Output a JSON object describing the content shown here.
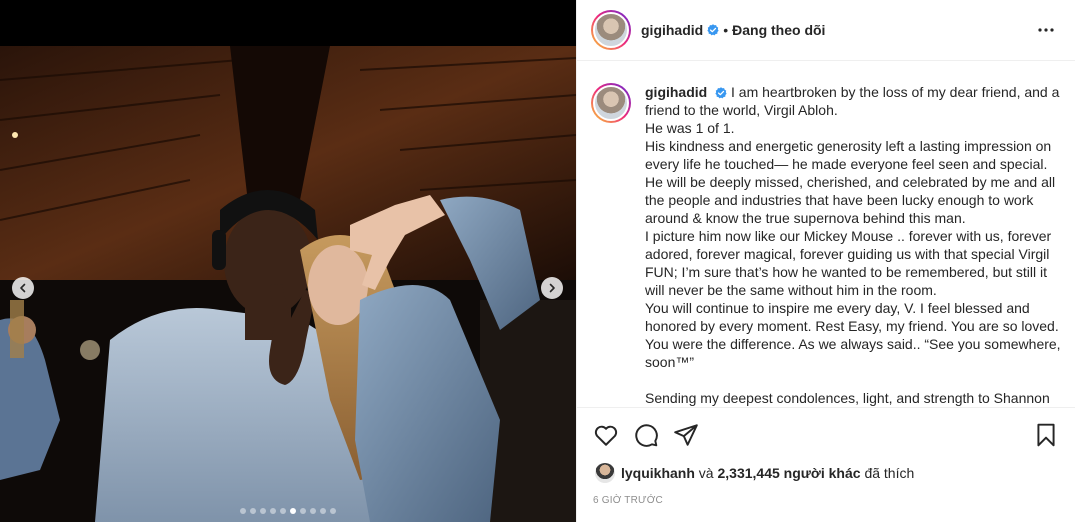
{
  "post": {
    "username": "gigihadid",
    "separator": "•",
    "follow_status": "Đang theo dõi",
    "caption": {
      "username": "gigihadid",
      "lines": [
        "I am heartbroken by the loss of my dear friend, and a friend to the world, Virgil Abloh.",
        "He was 1 of 1.",
        "His kindness and energetic generosity left a lasting impression on every life he touched— he made everyone feel seen and special. He will be deeply missed, cherished, and celebrated by me and all the people and industries that have been lucky enough to work around & know the true supernova behind this man.",
        "I picture him now like our Mickey Mouse .. forever with us, forever adored, forever magical, forever guiding us with that special Virgil FUN; I’m sure that’s how he wanted to be remembered, but still it will never be the same without him in the room.",
        "You will continue to inspire me every day, V. I feel blessed and honored by every moment. Rest Easy, my friend. You are so loved. You were the difference. As we always said.. “See you somewhere, soon™”",
        "",
        "Sending my deepest condolences, light, and strength to Shannon"
      ]
    },
    "likes": {
      "liker": "lyquikhanh",
      "conj": "và",
      "others": "2,331,445 người khác",
      "suffix": "đã thích"
    },
    "timestamp": "6 GIỜ TRƯỚC",
    "carousel": {
      "total": 10,
      "active_index": 5
    }
  },
  "icons": {
    "verified": "verified-badge-icon",
    "more": "more-options-icon",
    "like": "heart-icon",
    "comment": "comment-icon",
    "share": "send-icon",
    "save": "bookmark-icon",
    "prev": "chevron-left-icon",
    "next": "chevron-right-icon"
  },
  "colors": {
    "verified": "#3897f0",
    "text": "#262626",
    "muted": "#8e8e8e",
    "border": "#efefef"
  }
}
